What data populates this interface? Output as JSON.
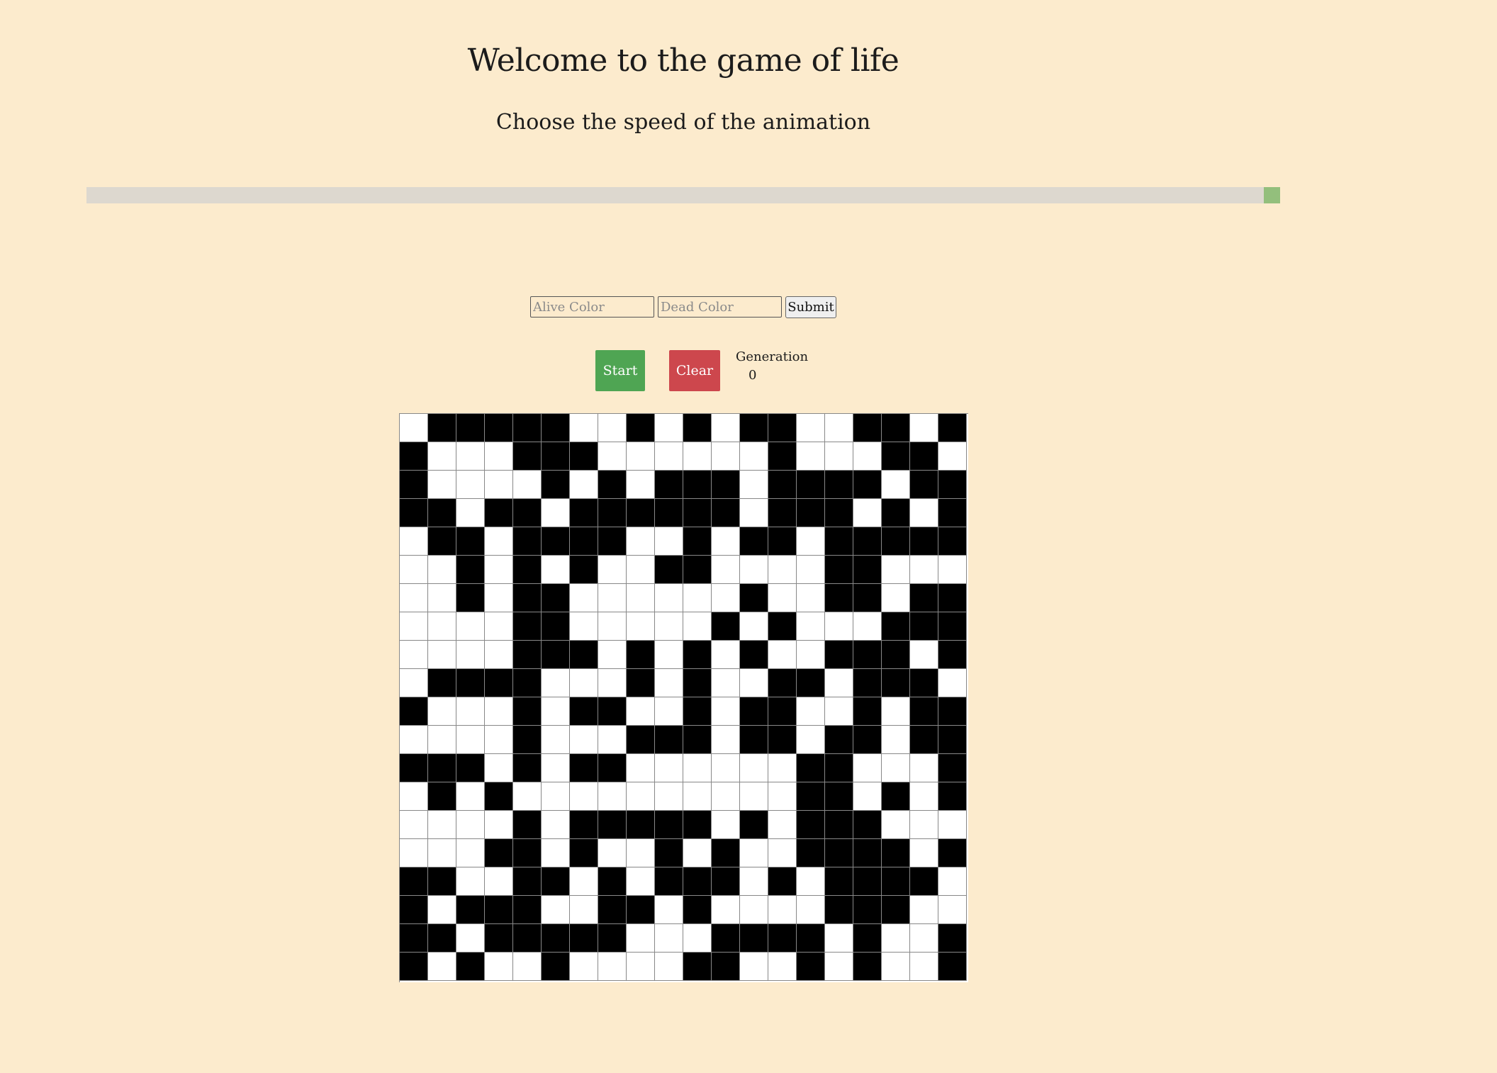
{
  "header": {
    "title": "Welcome to the game of life",
    "subtitle": "Choose the speed of the animation"
  },
  "speed_slider": {
    "value": 1.0
  },
  "color_form": {
    "alive_placeholder": "Alive Color",
    "dead_placeholder": "Dead Color",
    "submit_label": "Submit"
  },
  "controls": {
    "start_label": "Start",
    "clear_label": "Clear",
    "generation_label": "Generation",
    "generation_value": "0"
  },
  "colors": {
    "background": "#fcebcd",
    "alive": "#000000",
    "dead": "#ffffff",
    "start_button": "#4fa553",
    "clear_button": "#cd474d",
    "slider_track": "#ddd8cf",
    "slider_thumb": "#93bf7c"
  },
  "grid": {
    "rows": 20,
    "cols": 20,
    "cells": [
      "01111100101011001101",
      "10001110000001000110",
      "10000101011101111011",
      "11011011111101110101",
      "01101111001011011111",
      "00101010011000011000",
      "00101100000010011011",
      "00001100000101000111",
      "00001110101010011101",
      "01111000101001101110",
      "10001011001011001011",
      "00001000111011011011",
      "11101011000000110001",
      "01010000000000110101",
      "00001011111010111000",
      "00011010010100111101",
      "11001101011101011110",
      "10111001101000011100",
      "11011111000111101001",
      "10100100001100101001"
    ]
  }
}
